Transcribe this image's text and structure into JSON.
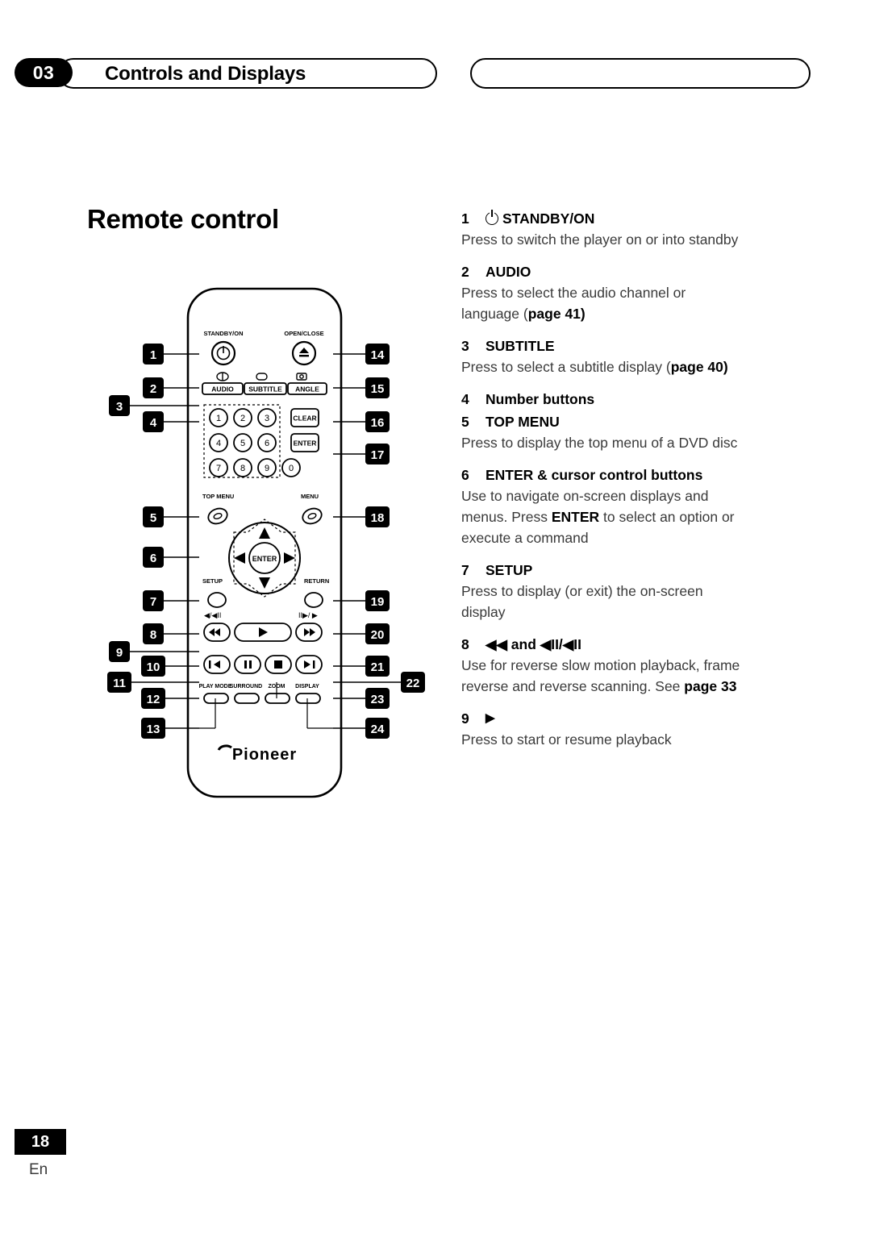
{
  "header": {
    "chapter": "03",
    "title": "Controls and Displays"
  },
  "page_title": "Remote control",
  "footer": {
    "page_number": "18",
    "language": "En"
  },
  "remote": {
    "brand": "Pioneer",
    "labels": {
      "standby_on": "STANDBY/ON",
      "open_close": "OPEN/CLOSE",
      "audio": "AUDIO",
      "subtitle": "SUBTITLE",
      "angle": "ANGLE",
      "clear": "CLEAR",
      "enter": "ENTER",
      "top_menu": "TOP MENU",
      "menu": "MENU",
      "setup": "SETUP",
      "return": "RETURN",
      "play_mode": "PLAY MODE",
      "surround": "SURROUND",
      "zoom": "ZOOM",
      "display": "DISPLAY",
      "slow_rev": "◀ / ◀II",
      "slow_fwd": "II▶ / ▶"
    },
    "number_keys": [
      "1",
      "2",
      "3",
      "4",
      "5",
      "6",
      "7",
      "8",
      "9",
      "0"
    ],
    "callouts": [
      "1",
      "2",
      "3",
      "4",
      "5",
      "6",
      "7",
      "8",
      "9",
      "10",
      "11",
      "12",
      "13",
      "14",
      "15",
      "16",
      "17",
      "18",
      "19",
      "20",
      "21",
      "22",
      "23",
      "24"
    ]
  },
  "items": [
    {
      "num": "1",
      "label": "STANDBY/ON",
      "has_power_icon": true,
      "body": [
        {
          "t": "Press to switch the player on or into standby"
        }
      ]
    },
    {
      "num": "2",
      "label": "AUDIO",
      "body": [
        {
          "t": "Press to select the audio channel or"
        },
        {
          "t": "language (",
          "b": "page",
          "t2": " 41)"
        }
      ]
    },
    {
      "num": "3",
      "label": "SUBTITLE",
      "body": [
        {
          "t": "Press to select a subtitle display (",
          "b": "page",
          "t2": " 40)"
        }
      ]
    },
    {
      "num": "4",
      "label": "Number buttons",
      "body": []
    },
    {
      "num": "5",
      "label": "TOP MENU",
      "body": [
        {
          "t": "Press to display the top menu of a DVD disc"
        }
      ]
    },
    {
      "num": "6",
      "label": "ENTER & cursor control buttons",
      "body": [
        {
          "t": "Use to navigate on-screen displays and"
        },
        {
          "t": "menus. Press ",
          "b": "ENTER",
          "t2": " to select an option or"
        },
        {
          "t": "execute a command"
        }
      ]
    },
    {
      "num": "7",
      "label": "SETUP",
      "body": [
        {
          "t": "Press to display (or exit) the on-screen"
        },
        {
          "t": "display"
        }
      ]
    },
    {
      "num": "8",
      "label": "◀◀ and ◀II/◀II",
      "body": [
        {
          "t": "Use for reverse slow motion playback, frame"
        },
        {
          "t": "reverse and reverse scanning. See ",
          "b": "page",
          "t2": " 33"
        }
      ]
    },
    {
      "num": "9",
      "label": "▶",
      "body": [
        {
          "t": "Press to start or resume playback"
        }
      ]
    }
  ],
  "text": {
    "l1_1": "Press to switch the player on or into standby",
    "l2_1": "Press to select the audio channel or",
    "l2_2a": "language (",
    "l2_2b": "page",
    "l2_2c": " 41)",
    "l3_1a": "Press to select a subtitle display (",
    "l3_1b": "page",
    "l3_1c": " 40)",
    "l5_1": "Press to display the top menu of a DVD disc",
    "l6_1": "Use to navigate on-screen displays and",
    "l6_2a": "menus. Press ",
    "l6_2b": "ENTER",
    "l6_2c": " to select an option or",
    "l6_3": "execute a command",
    "l7_1": "Press to display (or exit) the on-screen",
    "l7_2": "display",
    "l8_1": "Use for reverse slow motion playback, frame",
    "l8_2a": "reverse and reverse scanning. See ",
    "l8_2b": "page",
    "l8_2c": " 33",
    "l9_1": "Press to start or resume playback"
  },
  "labels": {
    "n1": "1",
    "n2": "2",
    "n3": "3",
    "n4": "4",
    "n5": "5",
    "n6": "6",
    "n7": "7",
    "n8": "8",
    "n9": "9",
    "h1": "STANDBY/ON",
    "h2": "AUDIO",
    "h3": "SUBTITLE",
    "h4": "Number buttons",
    "h5": "TOP MENU",
    "h6": "ENTER & cursor control buttons",
    "h7": "SETUP",
    "h8": "◀◀ and ◀II/◀II",
    "h9": "▶"
  }
}
